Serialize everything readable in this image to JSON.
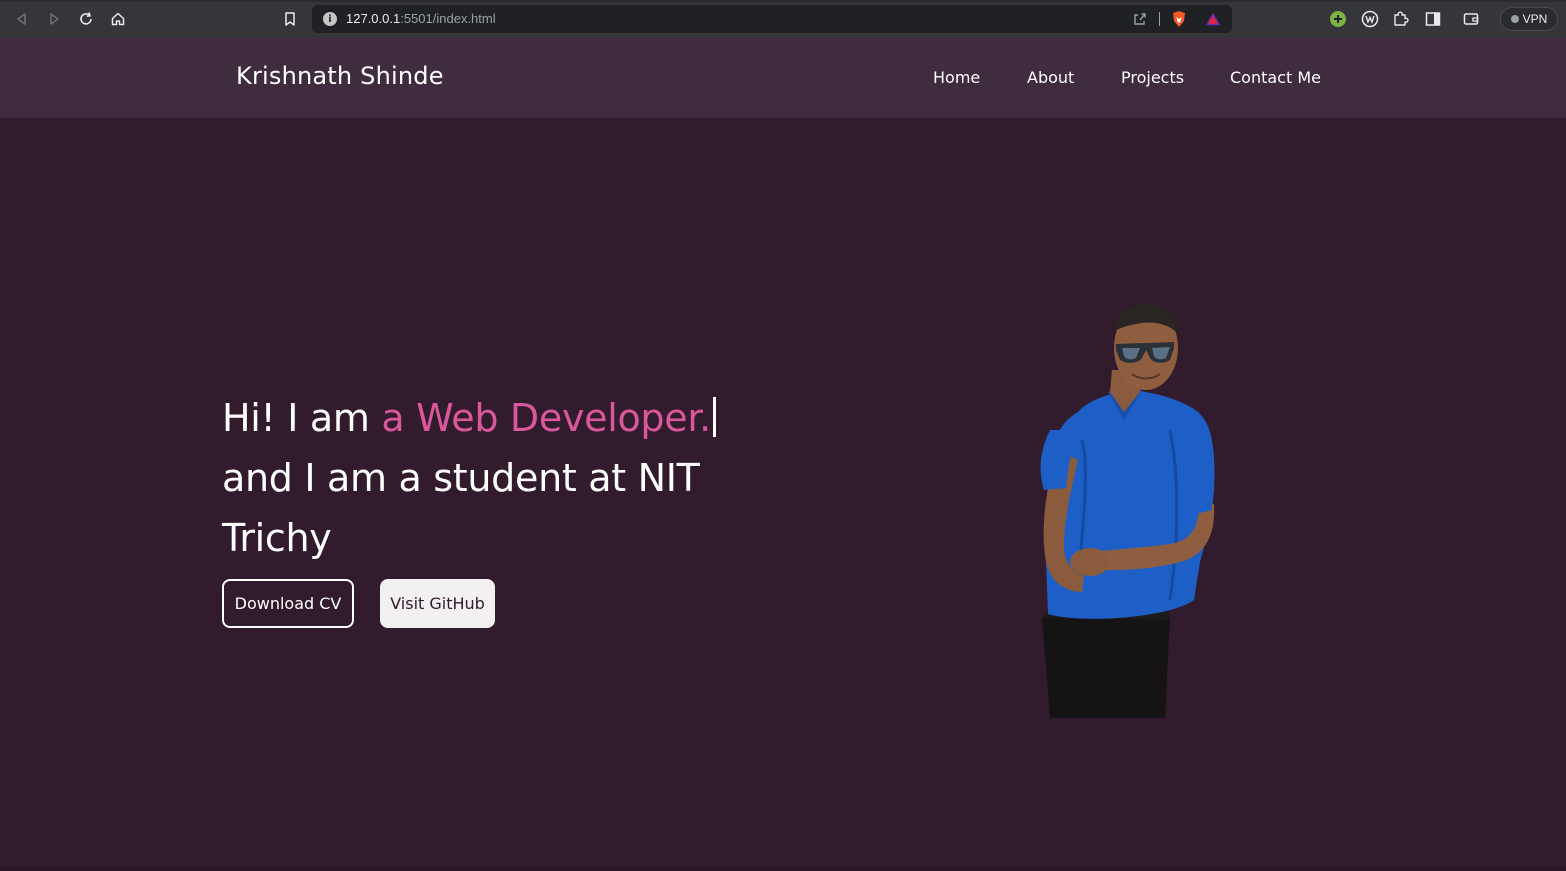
{
  "browser": {
    "url_host": "127.0.0.1",
    "url_path": ":5501/index.html",
    "vpn_label": "VPN"
  },
  "site": {
    "brand": "Krishnath Shinde",
    "nav": {
      "home": "Home",
      "about": "About",
      "projects": "Projects",
      "contact": "Contact Me"
    }
  },
  "hero": {
    "line1_prefix": "Hi! I am ",
    "line1_typed": "a Web Developer.",
    "line2": "and I am a student at NIT",
    "line3": "Trichy",
    "download_cv": "Download CV",
    "visit_github": "Visit GitHub"
  },
  "colors": {
    "page_bg": "#321b2d",
    "nav_bg": "#3f2c3e",
    "accent": "#d9589c",
    "text": "#ffffff"
  }
}
